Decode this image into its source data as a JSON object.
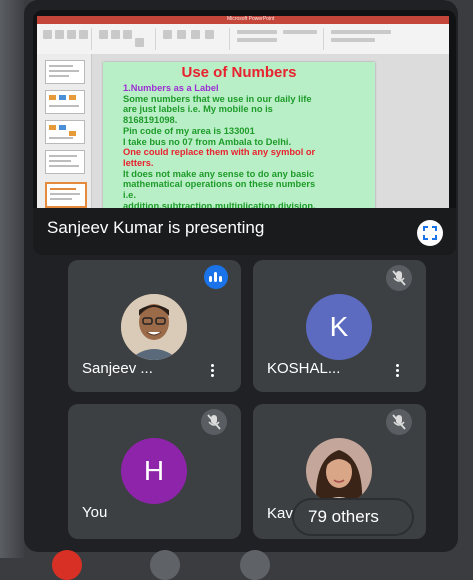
{
  "presentation": {
    "app_title": "Microsoft PowerPoint",
    "slide_title": "Use of Numbers",
    "slide_lines": [
      {
        "text": "1.Numbers as a Label",
        "color": "#9b2fd4"
      },
      {
        "text": "Some numbers that we use in our daily life",
        "color": "#1e9b2a"
      },
      {
        "text": "are just labels i.e. My mobile no is",
        "color": "#1e9b2a"
      },
      {
        "text": "8168191098.",
        "color": "#1e9b2a"
      },
      {
        "text": "Pin code of my area is 133001",
        "color": "#1e9b2a"
      },
      {
        "text": "I take bus no 07 from Ambala to Delhi.",
        "color": "#1e9b2a"
      },
      {
        "text": "One  could replace them with any symbol or",
        "color": "#e8222e"
      },
      {
        "text": "letters.",
        "color": "#e8222e"
      },
      {
        "text": "It does not make any sense to do any basic",
        "color": "#1e9b2a"
      },
      {
        "text": "mathematical operations on these numbers",
        "color": "#1e9b2a"
      },
      {
        "text": "i.e.",
        "color": "#1e9b2a"
      },
      {
        "text": "addition,subtraction,multiplication,division.",
        "color": "#1e9b2a"
      }
    ],
    "presenter_label": "Sanjeev Kumar is presenting"
  },
  "participants": [
    {
      "name": "Sanjeev ...",
      "avatar": "photo",
      "status": "speaking"
    },
    {
      "name": "KOSHAL...",
      "avatar_letter": "K",
      "avatar_color": "#5c6bc0",
      "status": "muted"
    },
    {
      "name": "You",
      "avatar_letter": "H",
      "avatar_color": "#8e24aa",
      "status": "muted"
    },
    {
      "name": "Kav",
      "avatar": "photo",
      "status": "muted"
    }
  ],
  "others_label": "79 others",
  "colors": {
    "stage_bg": "#202124",
    "tile_bg": "#3c4043",
    "accent_blue": "#1a73e8"
  },
  "icons": [
    "fullscreen-icon",
    "mic-off-icon",
    "speaking-indicator-icon",
    "more-vert-icon"
  ]
}
